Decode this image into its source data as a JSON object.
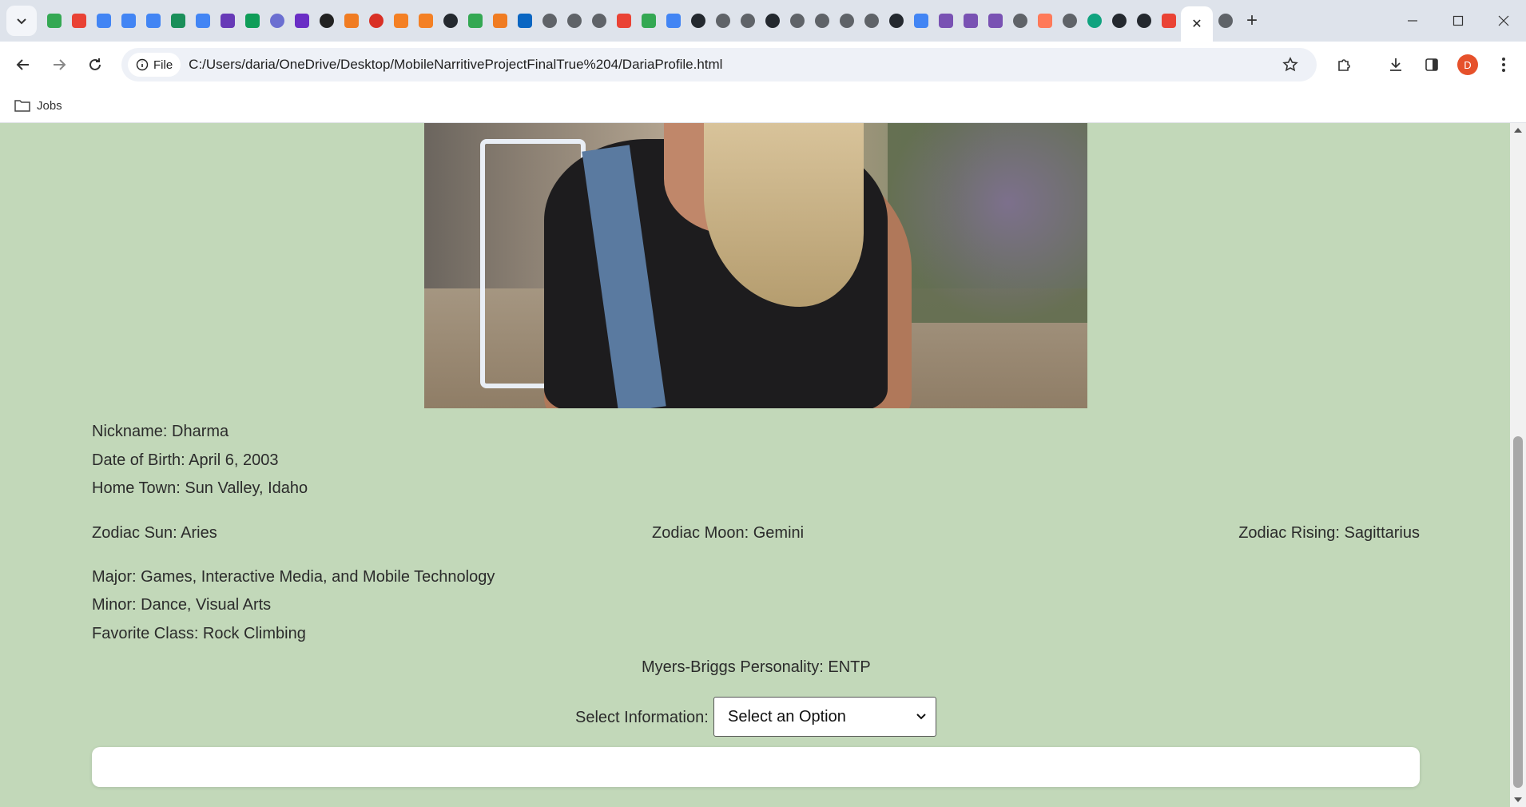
{
  "tabs": {
    "active_close_glyph": "✕",
    "new_tab_glyph": "+",
    "favicons": [
      {
        "name": "google-drive-icon",
        "color": "#34a853"
      },
      {
        "name": "app-icon",
        "color": "#e94235"
      },
      {
        "name": "google-docs-icon",
        "color": "#4285f4"
      },
      {
        "name": "google-docs-icon",
        "color": "#4285f4"
      },
      {
        "name": "google-docs-icon",
        "color": "#4285f4"
      },
      {
        "name": "w-icon",
        "color": "#1a8f5a"
      },
      {
        "name": "google-docs-icon",
        "color": "#4285f4"
      },
      {
        "name": "forms-icon",
        "color": "#673ab7"
      },
      {
        "name": "sheets-icon",
        "color": "#0f9d58"
      },
      {
        "name": "globe-icon",
        "color": "#6b6fd1"
      },
      {
        "name": "star-icon",
        "color": "#6a2ec5"
      },
      {
        "name": "play-icon",
        "color": "#222222"
      },
      {
        "name": "b-icon",
        "color": "#f07c22"
      },
      {
        "name": "badge-icon",
        "color": "#d93025"
      },
      {
        "name": "stack-icon",
        "color": "#f48024"
      },
      {
        "name": "stack-icon",
        "color": "#f48024"
      },
      {
        "name": "github-icon",
        "color": "#24292f"
      },
      {
        "name": "google-drive-icon",
        "color": "#34a853"
      },
      {
        "name": "b-icon",
        "color": "#f07c22"
      },
      {
        "name": "linkedin-icon",
        "color": "#0a66c2"
      },
      {
        "name": "globe-icon",
        "color": "#5f6368"
      },
      {
        "name": "globe-icon",
        "color": "#5f6368"
      },
      {
        "name": "globe-icon",
        "color": "#5f6368"
      },
      {
        "name": "gmail-icon",
        "color": "#ea4335"
      },
      {
        "name": "google-drive-icon",
        "color": "#34a853"
      },
      {
        "name": "google-docs-icon",
        "color": "#4285f4"
      },
      {
        "name": "github-icon",
        "color": "#24292f"
      },
      {
        "name": "globe-icon",
        "color": "#5f6368"
      },
      {
        "name": "globe-icon",
        "color": "#5f6368"
      },
      {
        "name": "github-icon",
        "color": "#24292f"
      },
      {
        "name": "globe-icon",
        "color": "#5f6368"
      },
      {
        "name": "globe-icon",
        "color": "#5f6368"
      },
      {
        "name": "globe-icon",
        "color": "#5f6368"
      },
      {
        "name": "globe-icon",
        "color": "#5f6368"
      },
      {
        "name": "github-icon",
        "color": "#24292f"
      },
      {
        "name": "google-icon",
        "color": "#4285f4"
      },
      {
        "name": "bootstrap-icon",
        "color": "#7952b3"
      },
      {
        "name": "bootstrap-icon",
        "color": "#7952b3"
      },
      {
        "name": "bootstrap-icon",
        "color": "#7952b3"
      },
      {
        "name": "globe-icon",
        "color": "#5f6368"
      },
      {
        "name": "hubspot-icon",
        "color": "#ff7a59"
      },
      {
        "name": "globe-icon",
        "color": "#5f6368"
      },
      {
        "name": "chatgpt-icon",
        "color": "#10a37f"
      },
      {
        "name": "github-icon",
        "color": "#24292f"
      },
      {
        "name": "github-icon",
        "color": "#24292f"
      },
      {
        "name": "gmail-icon",
        "color": "#ea4335"
      }
    ]
  },
  "address_bar": {
    "chip_label": "File",
    "url": "C:/Users/daria/OneDrive/Desktop/MobileNarritiveProjectFinalTrue%204/DariaProfile.html"
  },
  "profile_avatar": "D",
  "bookmarks": [
    {
      "label": "Jobs"
    }
  ],
  "profile": {
    "nickname": "Nickname: Dharma",
    "dob": "Date of Birth: April 6, 2003",
    "hometown": "Home Town: Sun Valley, Idaho",
    "zodiac_sun": "Zodiac Sun: Aries",
    "zodiac_moon": "Zodiac Moon: Gemini",
    "zodiac_rising": "Zodiac Rising: Sagittarius",
    "major": "Major: Games, Interactive Media, and Mobile Technology",
    "minor": "Minor: Dance, Visual Arts",
    "favorite_class": "Favorite Class: Rock Climbing",
    "myers_briggs": "Myers-Briggs Personality: ENTP"
  },
  "select": {
    "label": "Select Information:",
    "value": "Select an Option"
  },
  "colors": {
    "page_background": "#c2d8b9",
    "accent_avatar": "#e6512b"
  }
}
